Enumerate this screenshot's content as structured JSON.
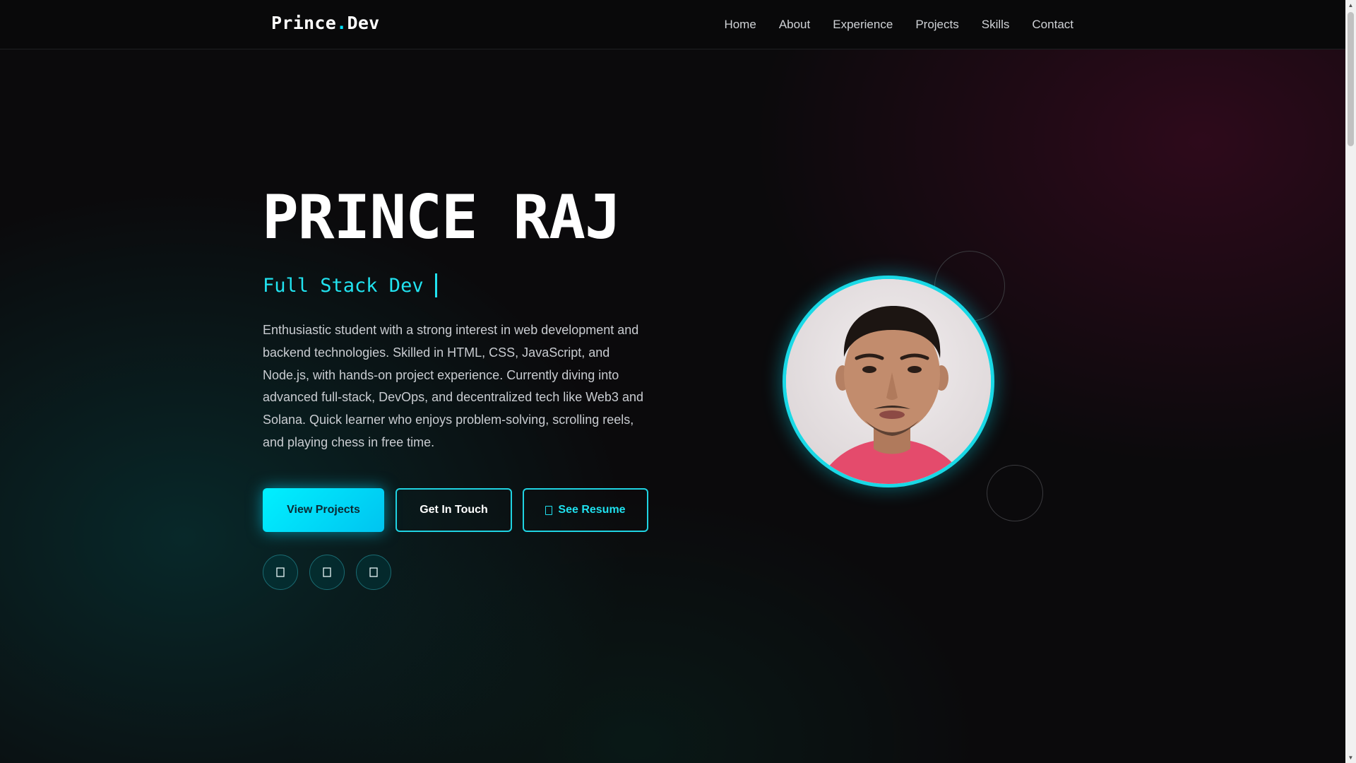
{
  "nav": {
    "logo_prefix": "Prince",
    "logo_dot": ".",
    "logo_suffix": "Dev",
    "links": [
      "Home",
      "About",
      "Experience",
      "Projects",
      "Skills",
      "Contact"
    ]
  },
  "hero": {
    "name": "PRINCE RAJ",
    "role": "Full Stack Dev",
    "bio": "Enthusiastic student with a strong interest in web development and backend technologies. Skilled in HTML, CSS, JavaScript, and Node.js, with hands-on project experience. Currently diving into advanced full-stack, DevOps, and decentralized tech like Web3 and Solana. Quick learner who enjoys problem-solving, scrolling reels, and playing chess in free time.",
    "buttons": {
      "view_projects": "View Projects",
      "get_in_touch": "Get In Touch",
      "see_resume": "See Resume"
    },
    "social_icons": [
      "social-icon-1",
      "social-icon-2",
      "social-icon-3"
    ]
  },
  "colors": {
    "accent": "#00e5ff",
    "background": "#0b0a0c",
    "text": "#ffffff",
    "muted_text": "#c9ccd1"
  }
}
